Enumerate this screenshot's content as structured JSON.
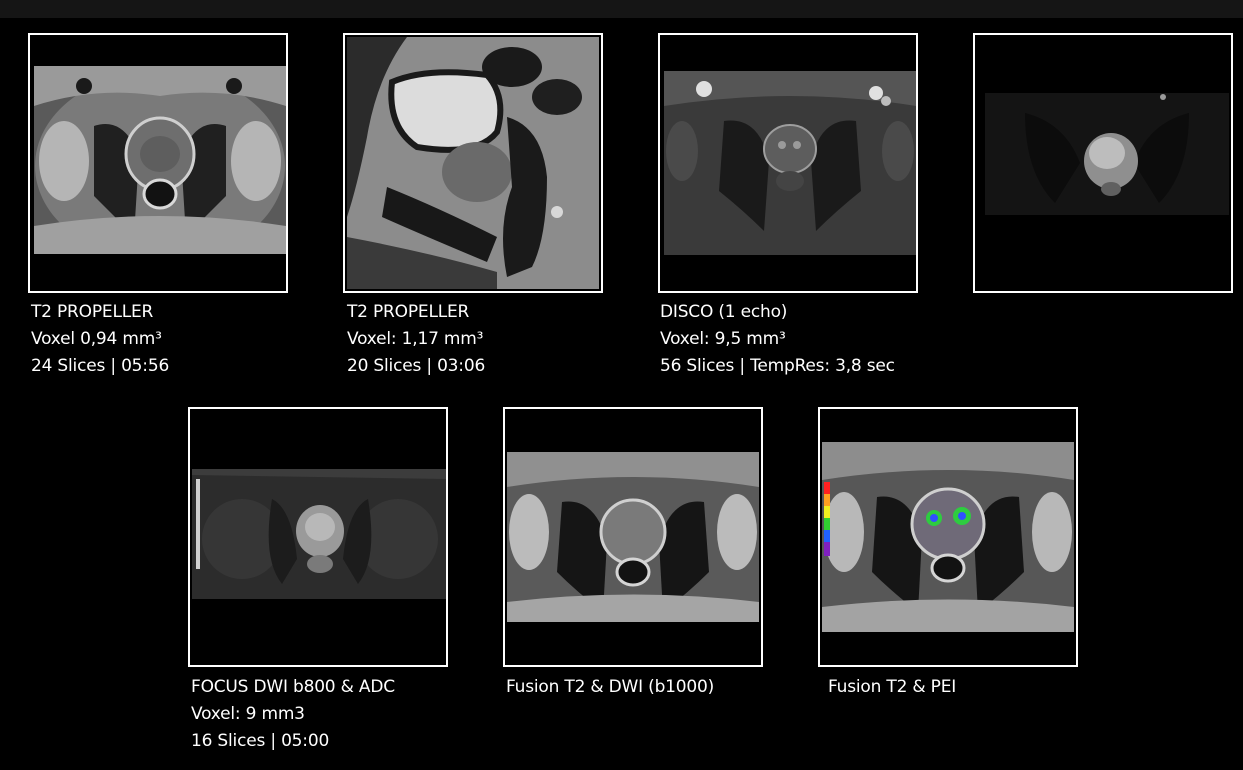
{
  "panels": [
    {
      "caption": [
        "T2 PROPELLER",
        "Voxel 0,94 mm³",
        "24 Slices | 05:56"
      ]
    },
    {
      "caption": [
        "T2 PROPELLER",
        "Voxel: 1,17 mm³",
        "20 Slices | 03:06"
      ]
    },
    {
      "caption": [
        "DISCO (1 echo)",
        "Voxel: 9,5 mm³",
        "56 Slices | TempRes: 3,8 sec"
      ]
    },
    {
      "caption": []
    },
    {
      "caption": [
        "FOCUS DWI b800 & ADC",
        "Voxel: 9 mm3",
        "16 Slices | 05:00"
      ]
    },
    {
      "caption": [
        "Fusion T2 & DWI (b1000)"
      ]
    },
    {
      "caption": [
        "Fusion T2 & PEI"
      ]
    }
  ],
  "colors": {
    "background": "#000000",
    "frame": "#ffffff",
    "text": "#ffffff"
  }
}
